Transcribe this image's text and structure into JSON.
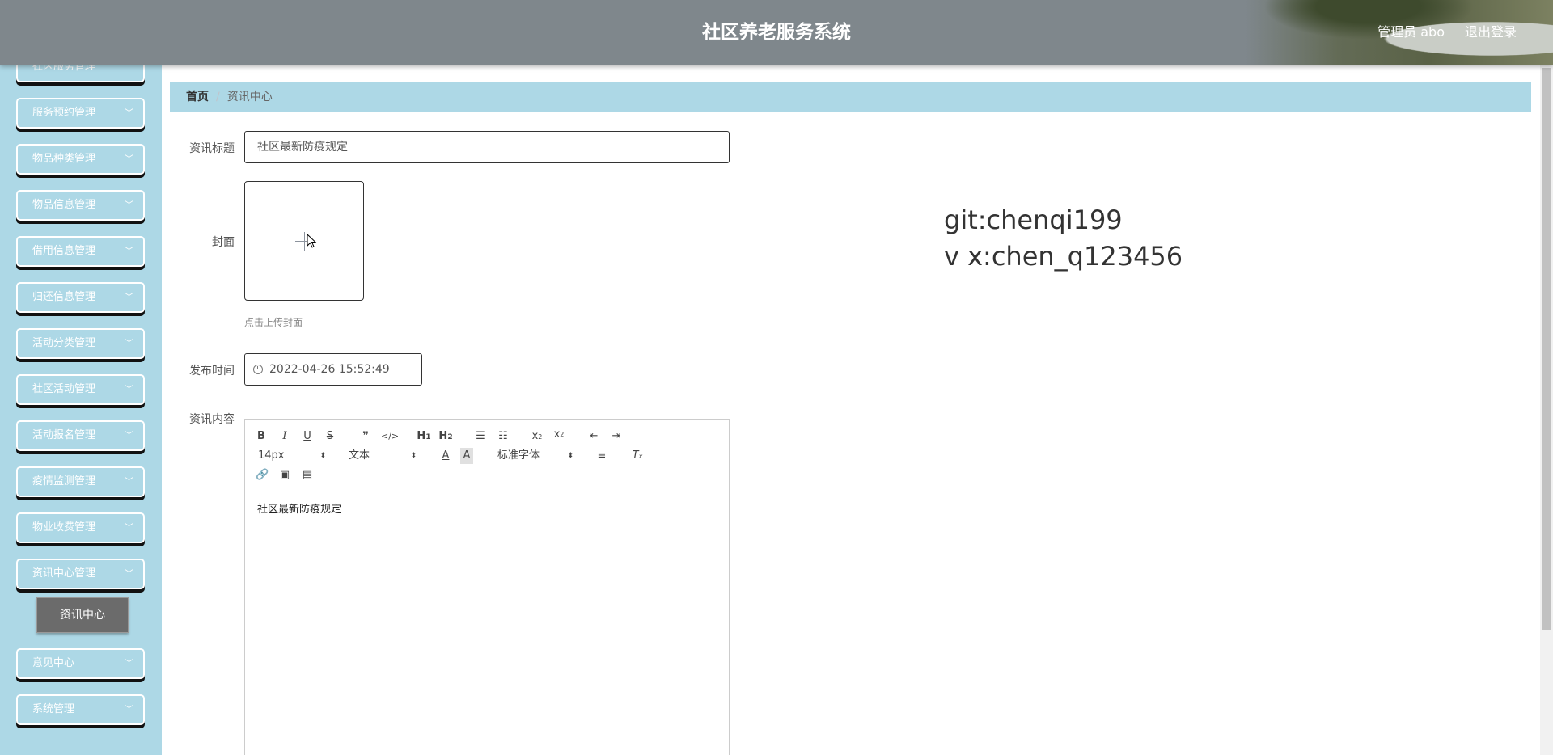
{
  "header": {
    "title": "社区养老服务系统",
    "user_label": "管理员 abo",
    "logout_label": "退出登录"
  },
  "sidebar": {
    "items": [
      {
        "label": "社区服务管理"
      },
      {
        "label": "服务预约管理"
      },
      {
        "label": "物品种类管理"
      },
      {
        "label": "物品信息管理"
      },
      {
        "label": "借用信息管理"
      },
      {
        "label": "归还信息管理"
      },
      {
        "label": "活动分类管理"
      },
      {
        "label": "社区活动管理"
      },
      {
        "label": "活动报名管理"
      },
      {
        "label": "疫情监测管理"
      },
      {
        "label": "物业收费管理"
      },
      {
        "label": "资讯中心管理"
      },
      {
        "label": "意见中心"
      },
      {
        "label": "系统管理"
      }
    ],
    "active_submenu": "资讯中心"
  },
  "breadcrumb": {
    "home": "首页",
    "separator": "/",
    "current": "资讯中心"
  },
  "form": {
    "title_label": "资讯标题",
    "title_value": "社区最新防疫规定",
    "cover_label": "封面",
    "cover_tip": "点击上传封面",
    "time_label": "发布时间",
    "time_value": "2022-04-26 15:52:49",
    "content_label": "资讯内容",
    "editor": {
      "font_size": "14px",
      "text_type": "文本",
      "font_family": "标准字体",
      "content": "社区最新防疫规定"
    }
  },
  "watermark": {
    "line1": "git:chenqi199",
    "line2": "v x:chen_q123456"
  },
  "colors": {
    "header_bg": "#7f878c",
    "sidebar_bg": "#add8e6",
    "breadcrumb_bg": "#add8e6",
    "submenu_active_bg": "#6b6b6b"
  }
}
